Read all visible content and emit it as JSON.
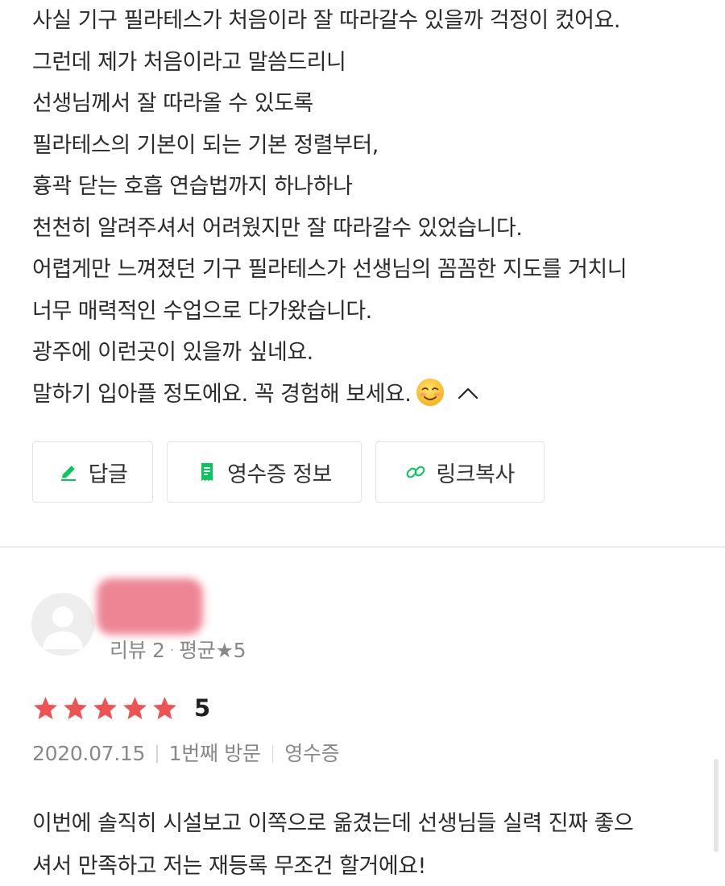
{
  "review1": {
    "lines": [
      "사실 기구 필라테스가 처음이라 잘 따라갈수 있을까 걱정이 컸어요.",
      "그런데 제가 처음이라고 말씀드리니",
      "선생님께서 잘 따라올 수 있도록",
      "필라테스의 기본이 되는 기본 정렬부터,",
      "흉곽 닫는 호흡 연습법까지 하나하나",
      "천천히 알려주셔서 어려웠지만 잘 따라갈수 있었습니다.",
      "어렵게만 느껴졌던 기구 필라테스가 선생님의 꼼꼼한 지도를 거치니",
      "너무 매력적인 수업으로 다가왔습니다.",
      "광주에 이런곳이 있을까 싶네요.",
      "말하기 입아플 정도에요. 꼭 경험해 보세요."
    ],
    "emoji": "smiling-face-emoji",
    "collapse_icon": "chevron-up-icon"
  },
  "actions": {
    "reply_label": "답글",
    "receipt_label": "영수증 정보",
    "link_label": "링크복사",
    "icon_color": "#03c75a"
  },
  "review2": {
    "user": {
      "stats_reviews": "리뷰 2",
      "stats_avg": "평균★5"
    },
    "rating": {
      "stars": 5,
      "value": "5",
      "star_color": "#ee5253"
    },
    "date": "2020.07.15",
    "visit": "1번째 방문",
    "receipt": "영수증",
    "lines": [
      "이번에 솔직히 시설보고 이쪽으로 옮겼는데 선생님들 실력 진짜 좋으",
      "셔서 만족하고 저는 재등록 무조건 할거에요!"
    ]
  }
}
